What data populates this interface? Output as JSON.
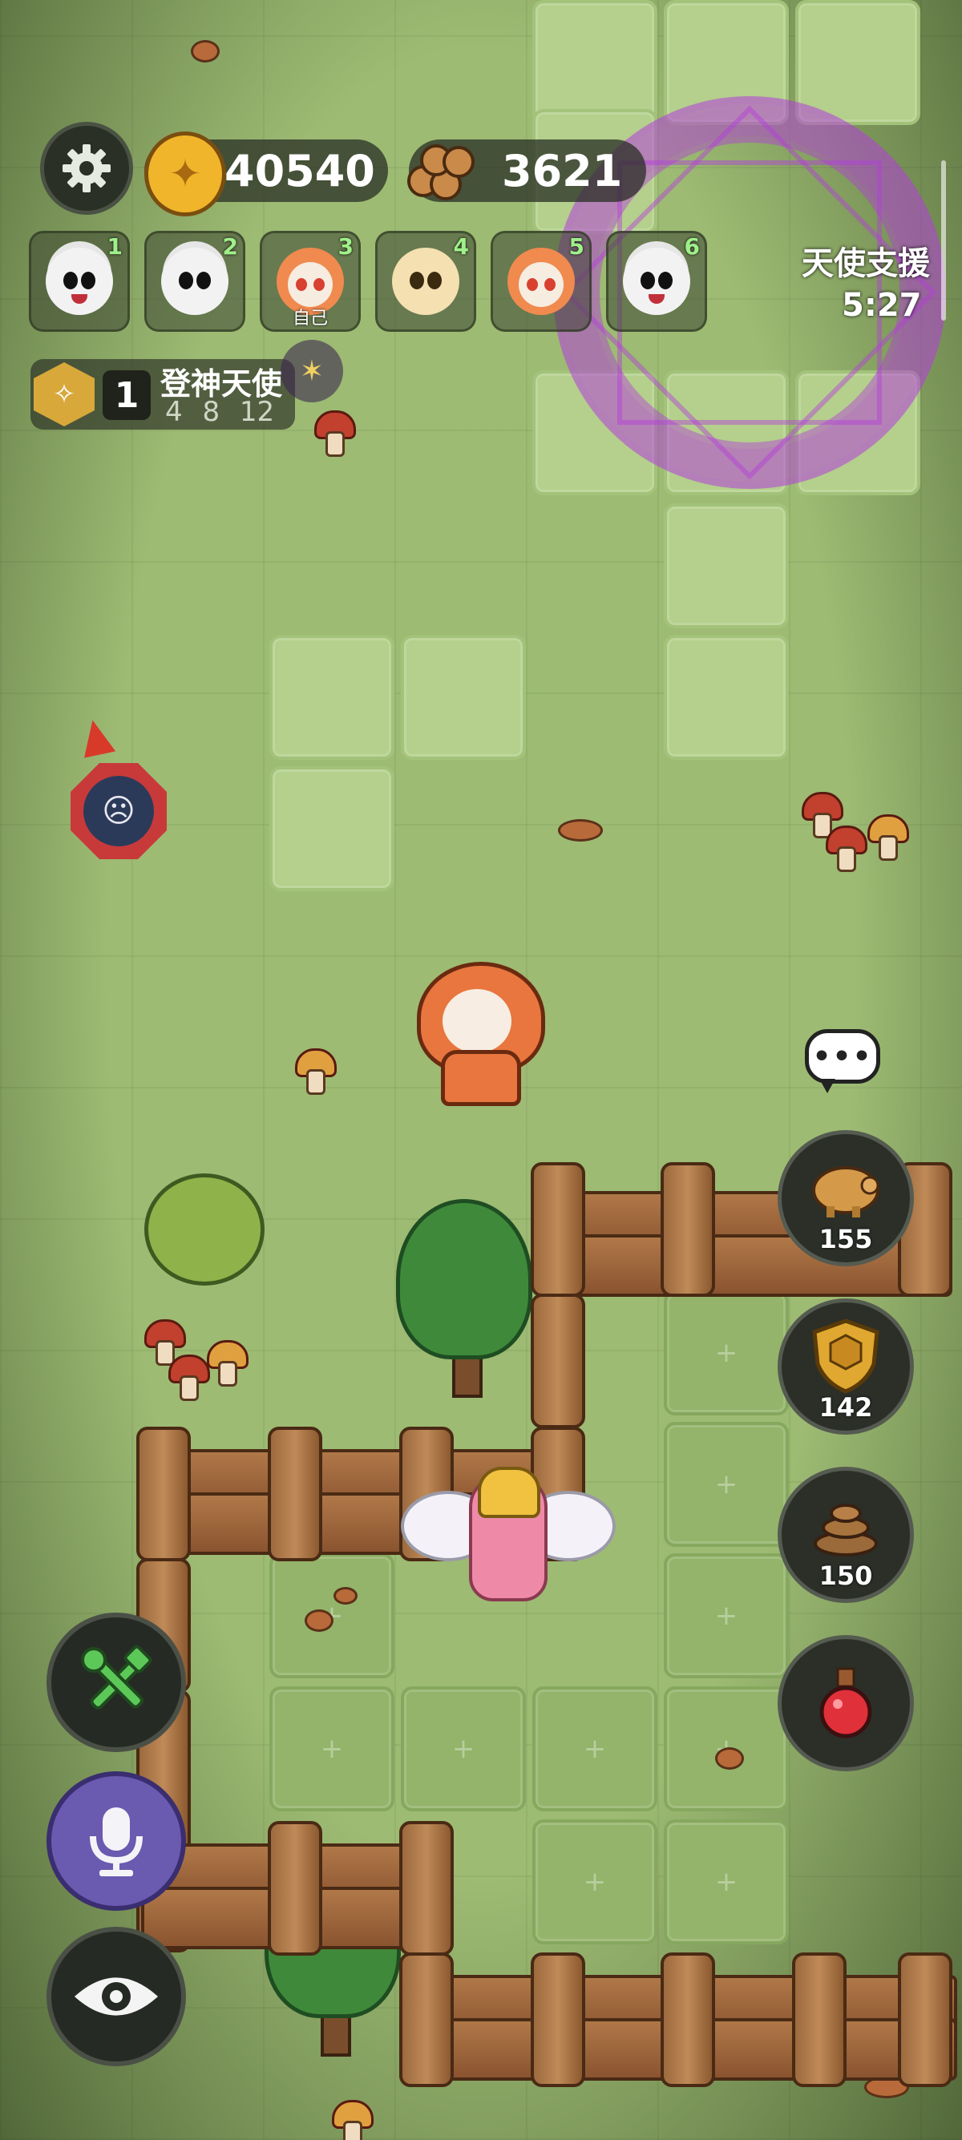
{
  "resources": {
    "coins": "40540",
    "wood": "3621"
  },
  "players": [
    {
      "num": "1",
      "kind": "sheep",
      "sub": ""
    },
    {
      "num": "2",
      "kind": "sheep",
      "sub": ""
    },
    {
      "num": "3",
      "kind": "bear",
      "sub": "自己"
    },
    {
      "num": "4",
      "kind": "chick",
      "sub": ""
    },
    {
      "num": "5",
      "kind": "bear",
      "sub": ""
    },
    {
      "num": "6",
      "kind": "sheep",
      "sub": ""
    }
  ],
  "support": {
    "title": "天使支援",
    "time": "5:27"
  },
  "rank": {
    "level": "1",
    "title": "登神天使",
    "step1": "4",
    "step2": "8",
    "step3": "12"
  },
  "side_items": [
    {
      "name": "piggy-bank",
      "count": "155"
    },
    {
      "name": "shield",
      "count": "142"
    },
    {
      "name": "poop",
      "count": "150"
    },
    {
      "name": "potion",
      "count": ""
    }
  ],
  "chat": {
    "label": "•••"
  },
  "icons": {
    "settings": "gear-icon",
    "coin": "coin-icon",
    "wood": "wood-icon",
    "build": "tools-icon",
    "voice": "microphone-icon",
    "view": "eye-icon"
  },
  "colors": {
    "accent_green": "#9ff08a",
    "magic_purple": "#b43cdc",
    "enemy_red": "#c83a3a"
  }
}
